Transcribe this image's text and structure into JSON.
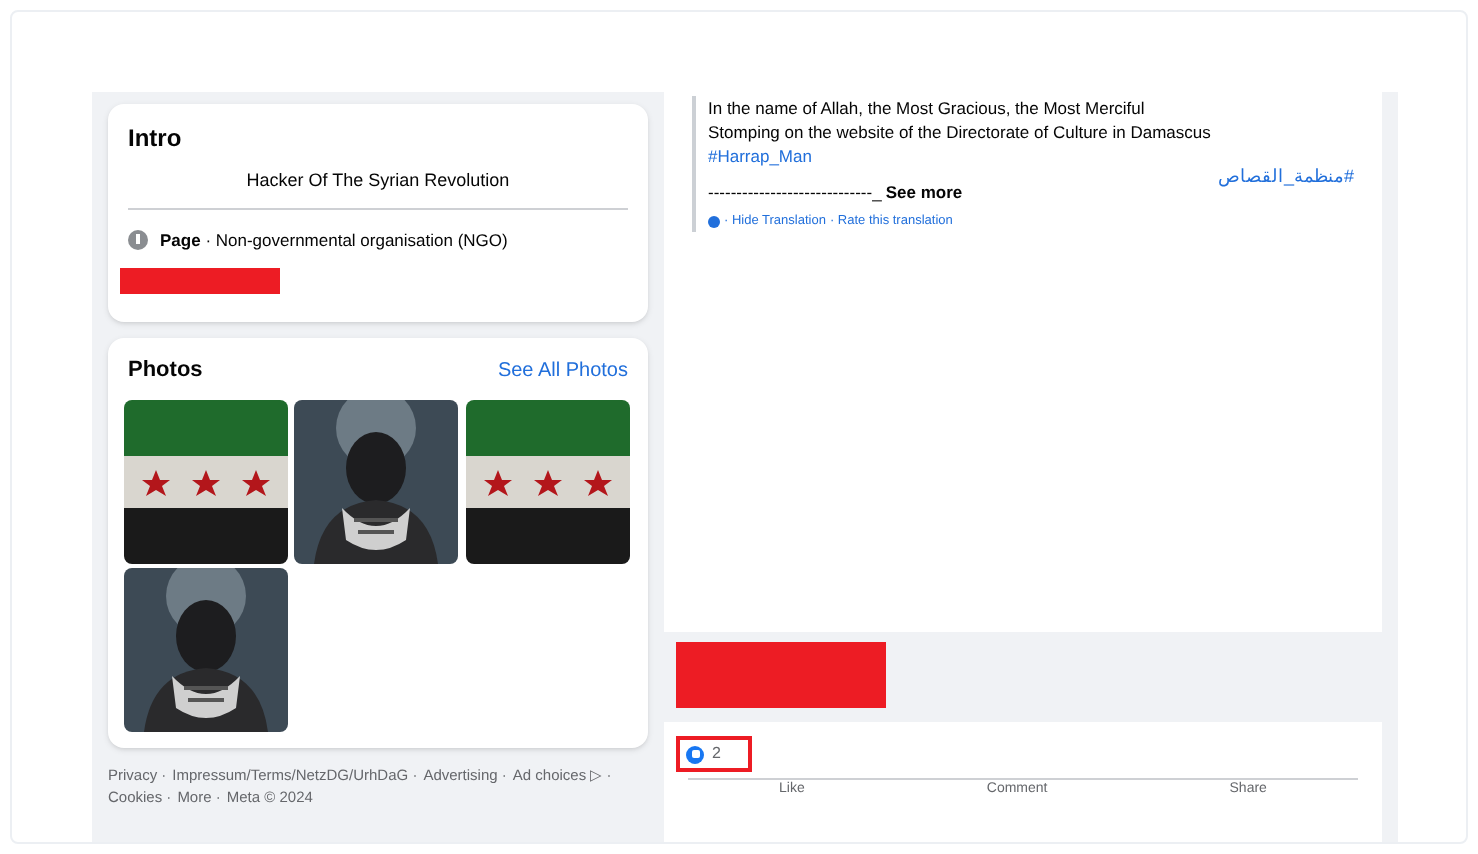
{
  "intro": {
    "title": "Intro",
    "bio": "Hacker Of The Syrian Revolution",
    "category_label": "Page",
    "category": " · Non-governmental organisation (NGO)"
  },
  "photos": {
    "title": "Photos",
    "link": "See All Photos",
    "items": [
      {
        "kind": "flag"
      },
      {
        "kind": "figure"
      },
      {
        "kind": "flag"
      },
      {
        "kind": "figure"
      }
    ]
  },
  "footer": {
    "links": [
      "Privacy ·",
      "Impressum/Terms/NetzDG/UrhDaG ·",
      "Advertising ·",
      "Ad choices ▷ ·",
      "Cookies ·",
      "More ·",
      "Meta © 2024"
    ]
  },
  "post": {
    "lines": [
      "In the name of Allah, the Most Gracious, the Most Merciful",
      "Stomping on the website of the Directorate of Culture in Damascus"
    ],
    "hashtag": "#Harrap_Man",
    "arabic_hashtag": "#منظمة_القصاص",
    "dashes": "-----------------------------_",
    "see_more": "See more",
    "hide_translation": "· Hide Translation",
    "rate_translation": "· Rate this translation",
    "reaction_count": "2",
    "actions": [
      "Like",
      "Comment",
      "Share"
    ]
  }
}
